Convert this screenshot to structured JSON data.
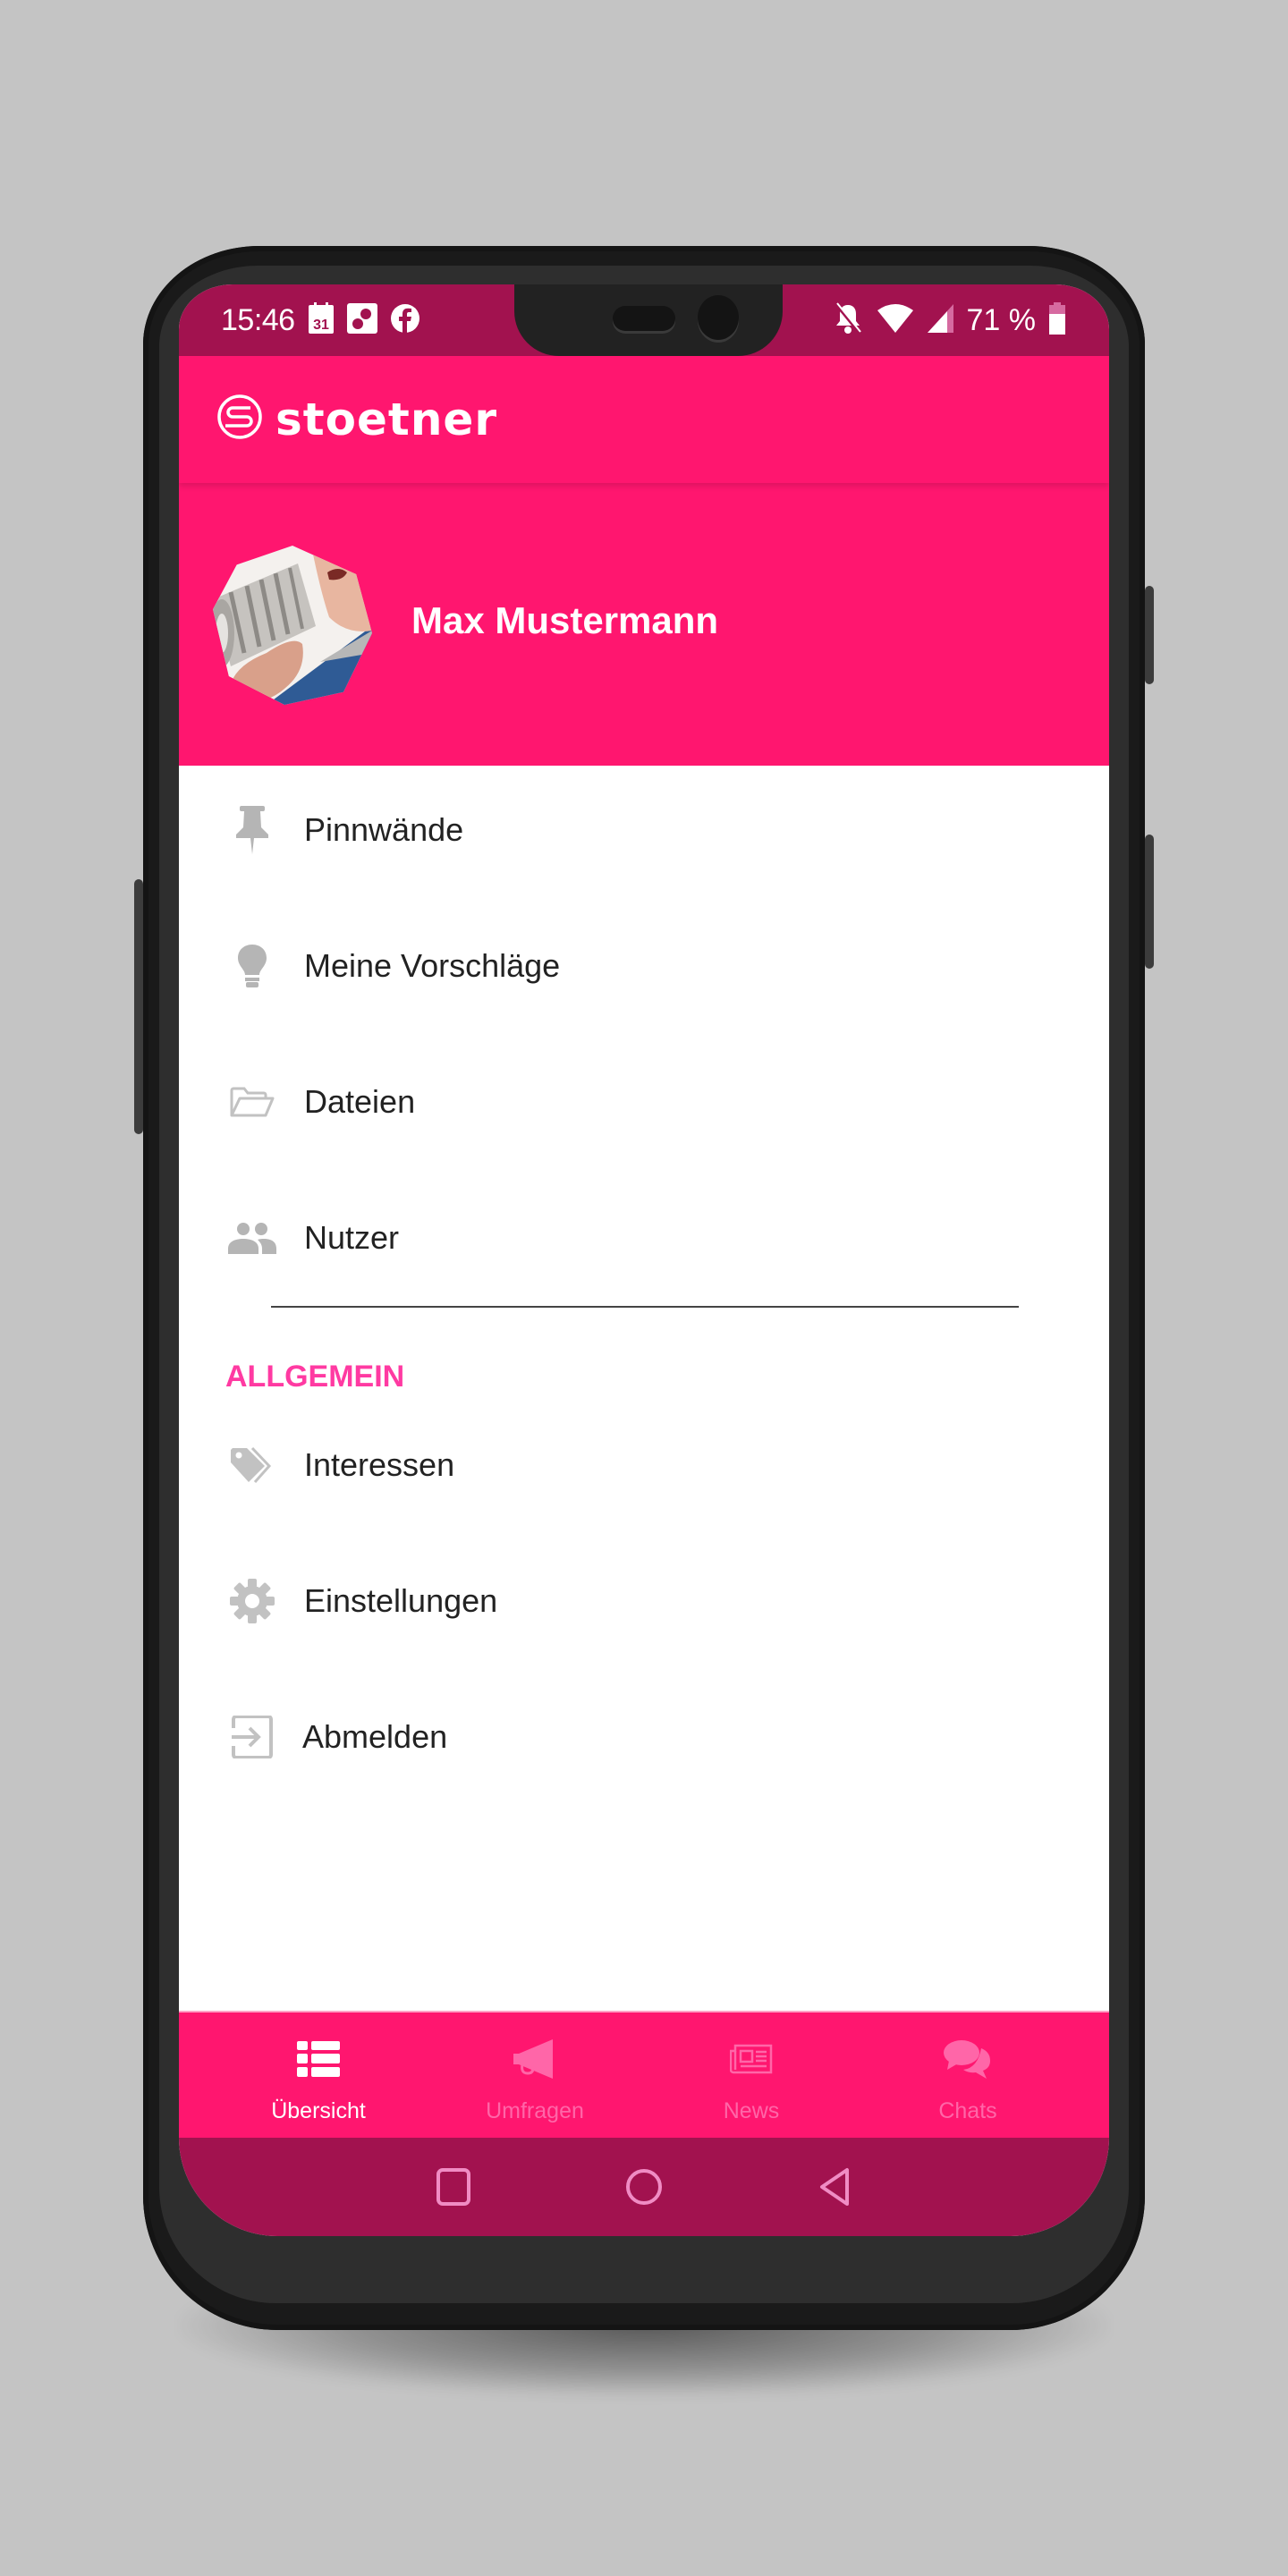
{
  "status_bar": {
    "time": "15:46",
    "left_icons": [
      "calendar-icon",
      "photos-icon",
      "facebook-icon"
    ],
    "calendar_day": "31",
    "right_icons": [
      "notifications-off-icon",
      "wifi-icon",
      "signal-icon",
      "battery-icon"
    ],
    "battery_percent": "71 %"
  },
  "app_bar": {
    "logo_text": "stoetner"
  },
  "profile": {
    "name": "Max Mustermann"
  },
  "menu": {
    "items": [
      {
        "label": "Pinnwände",
        "icon": "pin-icon"
      },
      {
        "label": "Meine Vorschläge",
        "icon": "lightbulb-icon"
      },
      {
        "label": "Dateien",
        "icon": "folder-open-icon"
      },
      {
        "label": "Nutzer",
        "icon": "users-icon"
      }
    ],
    "section_title": "ALLGEMEIN",
    "general_items": [
      {
        "label": "Interessen",
        "icon": "tags-icon"
      },
      {
        "label": "Einstellungen",
        "icon": "gear-icon"
      },
      {
        "label": "Abmelden",
        "icon": "sign-out-icon"
      }
    ]
  },
  "bottom_nav": {
    "items": [
      {
        "label": "Übersicht",
        "icon": "list-icon",
        "active": true
      },
      {
        "label": "Umfragen",
        "icon": "megaphone-icon",
        "active": false
      },
      {
        "label": "News",
        "icon": "newspaper-icon",
        "active": false
      },
      {
        "label": "Chats",
        "icon": "chat-bubbles-icon",
        "active": false
      }
    ]
  },
  "system_nav": {
    "buttons": [
      "recents-button",
      "home-button",
      "back-button"
    ]
  },
  "colors": {
    "primary": "#ff166f",
    "primary_dark": "#a2124f",
    "section_accent": "#ff3aa2",
    "icon_gray": "#b5b5b5",
    "text": "#222222"
  }
}
